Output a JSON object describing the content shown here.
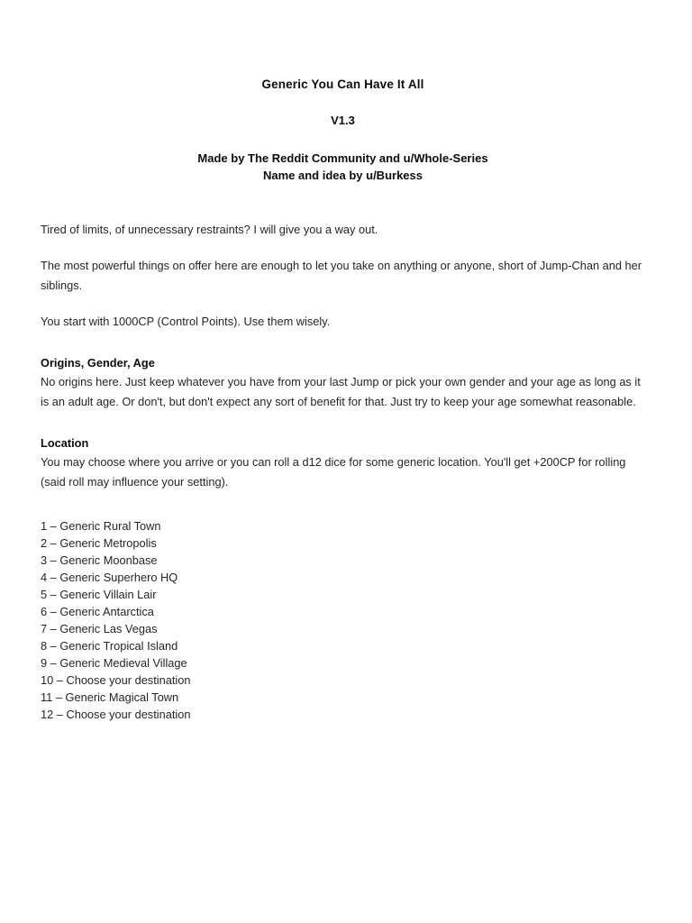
{
  "document": {
    "title": "Generic You Can Have It All",
    "version": "V1.3",
    "credits": {
      "line1": "Made by The Reddit Community and u/Whole-Series",
      "line2": "Name and idea by u/Burkess"
    },
    "intro": {
      "paragraph1": "Tired of limits, of unnecessary restraints? I will give you a way out.",
      "paragraph2": "The most powerful things on offer here are enough to let you take on anything or anyone, short of Jump-Chan and her siblings.",
      "paragraph3": "You start with 1000CP (Control Points). Use them wisely."
    },
    "sections": [
      {
        "heading": "Origins, Gender, Age",
        "body": "No origins here. Just keep whatever you have from your last Jump or pick your own gender and your age as long as it is an adult age. Or don't, but don't expect any sort of benefit for that. Just try to keep your age somewhat reasonable."
      },
      {
        "heading": "Location",
        "body": "You may choose where you arrive or you can roll a d12 dice for some generic location. You'll get +200CP for rolling (said roll may influence your setting)."
      }
    ],
    "location_table": {
      "dice": "d12",
      "roll_bonus": "+200CP",
      "entries": [
        "1 – Generic Rural Town",
        "2 – Generic Metropolis",
        "3 – Generic Moonbase",
        "4 – Generic Superhero HQ",
        "5 – Generic Villain Lair",
        "6 – Generic Antarctica",
        "7 – Generic Las Vegas",
        "8 – Generic Tropical Island",
        "9 – Generic Medieval Village",
        "10 – Choose your destination",
        "11 – Generic Magical Town",
        "12 – Choose your destination"
      ]
    },
    "colors": {
      "page_background": "#ffffff",
      "heading_text": "#0d0d0d",
      "body_text": "#262626"
    }
  }
}
